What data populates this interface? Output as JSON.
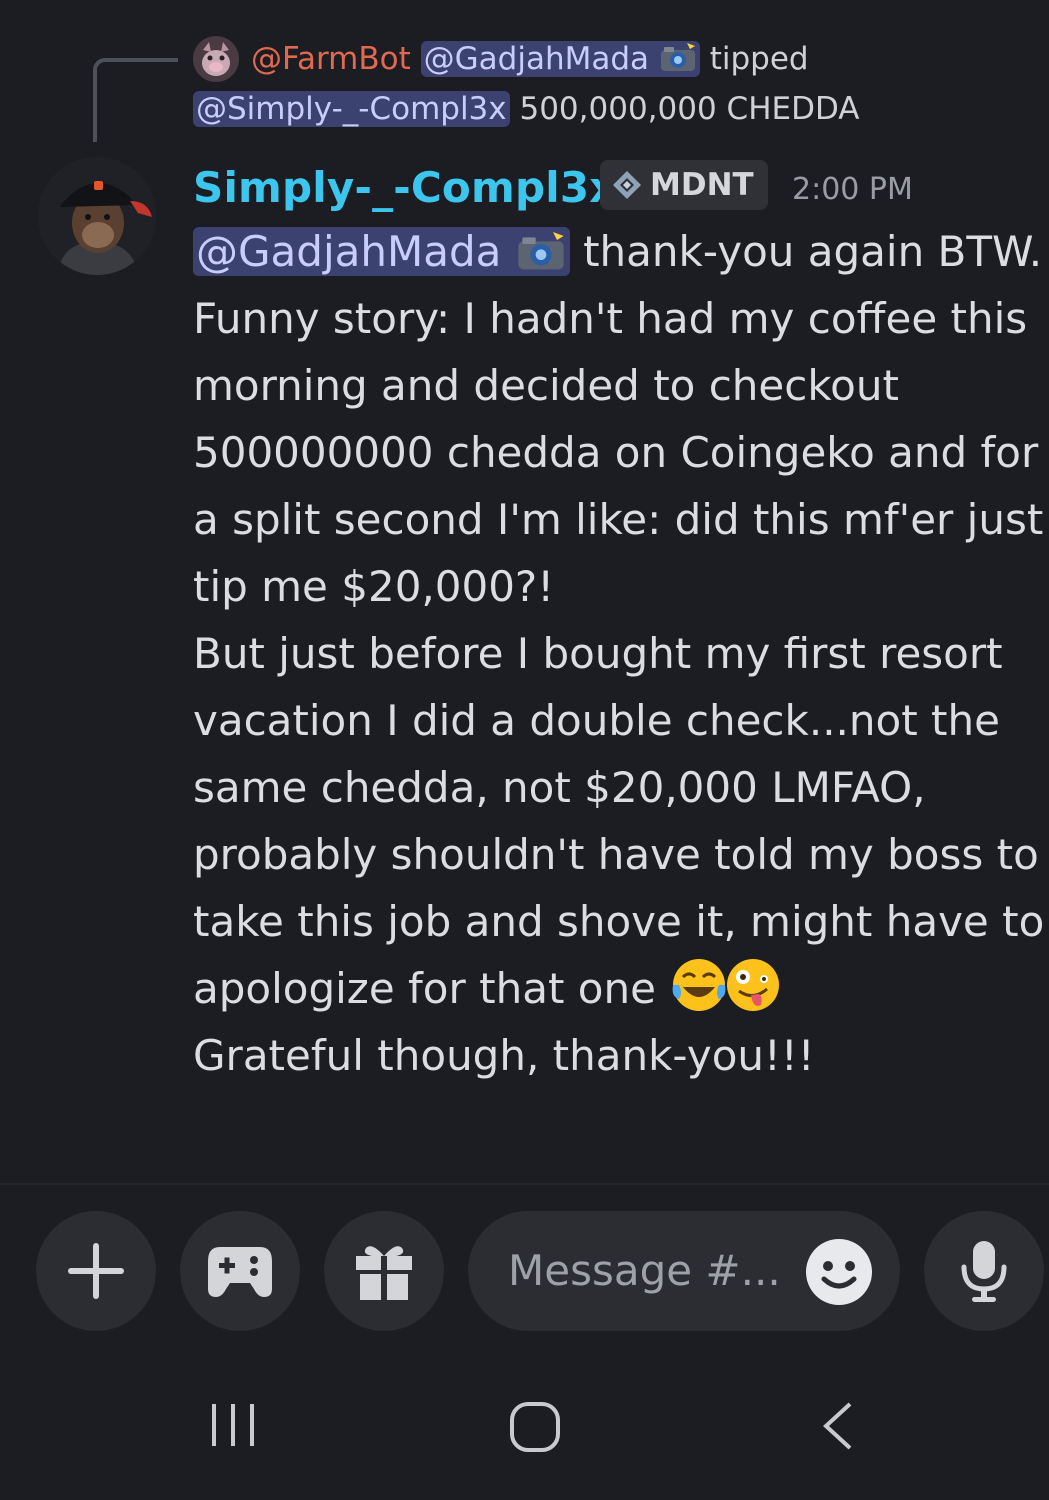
{
  "reply": {
    "bot_name": "@FarmBot",
    "mention_1": "@GadjahMada",
    "verb": "tipped",
    "mention_2": "@Simply-_-Compl3x",
    "amount": "500,000,000 CHEDDA"
  },
  "message": {
    "username": "Simply-_-Compl3x",
    "tag": "MDNT",
    "timestamp": "2:00 PM",
    "mention": "@GadjahMada",
    "lines": [
      "thank-you again BTW.",
      "Funny story: I hadn't had my coffee this",
      "morning and decided to checkout",
      "500000000 chedda on Coingeko and for",
      "a split second I'm like: did this mf'er just",
      "tip me $20,000?!",
      "But just before I bought my first resort",
      "vacation I did a double check...not the",
      "same chedda, not $20,000 LMFAO,",
      "probably shouldn't have told my boss to",
      "take this job and shove it, might have to",
      "apologize for that one",
      "Grateful though, thank-you!!!"
    ]
  },
  "composer": {
    "placeholder": "Message #..."
  },
  "icons": [
    "plus-icon",
    "gamepad-icon",
    "gift-icon",
    "emoji-icon",
    "microphone-icon",
    "recents-icon",
    "home-icon",
    "back-icon",
    "camera-flash-emoji",
    "laughing-tears-emoji",
    "zany-face-emoji",
    "diamond-tag-icon"
  ],
  "colors": {
    "background": "#1c1d22",
    "username": "#3cc6ee",
    "farmbot": "#e0694f",
    "mention_bg": "#3c4270",
    "mention_text": "#c9cdfb",
    "button_bg": "#2b2d33"
  }
}
